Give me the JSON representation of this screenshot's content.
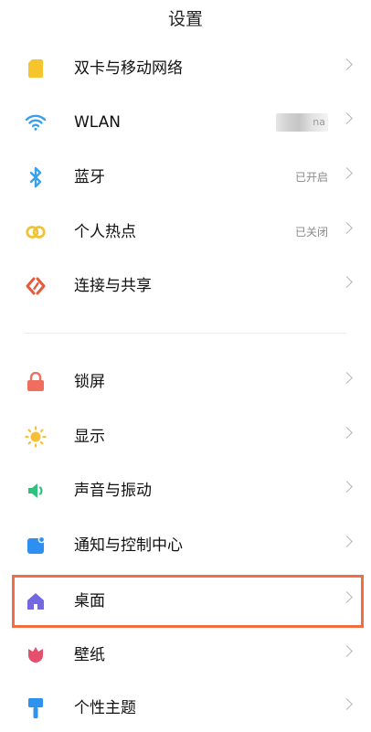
{
  "header": {
    "title": "设置"
  },
  "wlan_ssid_tail": "na",
  "colors": {
    "highlight": "#f16e43",
    "sim": "#f6c42c",
    "wlan": "#3aa0ea",
    "bluetooth": "#3aa0ea",
    "hotspot": "#f0c335",
    "connect": "#e55a3b",
    "lock": "#ef6e5d",
    "display": "#f7c034",
    "sound": "#2ec27e",
    "notify": "#2e8ef2",
    "home": "#7468e0",
    "wallpaper": "#e34f6d",
    "theme": "#2d93ee"
  },
  "sections": [
    {
      "items": [
        {
          "label": "双卡与移动网络",
          "icon": "sim-card-icon"
        },
        {
          "label": "WLAN",
          "icon": "wifi-icon"
        },
        {
          "label": "蓝牙",
          "status": "已开启",
          "icon": "bluetooth-icon"
        },
        {
          "label": "个人热点",
          "status": "已关闭",
          "icon": "hotspot-icon"
        },
        {
          "label": "连接与共享",
          "icon": "connect-share-icon"
        }
      ]
    },
    {
      "items": [
        {
          "label": "锁屏",
          "icon": "lock-icon"
        },
        {
          "label": "显示",
          "icon": "sun-icon"
        },
        {
          "label": "声音与振动",
          "icon": "speaker-icon"
        },
        {
          "label": "通知与控制中心",
          "icon": "notification-icon"
        },
        {
          "label": "桌面",
          "icon": "home-icon",
          "highlighted": true
        },
        {
          "label": "壁纸",
          "icon": "tulip-icon"
        },
        {
          "label": "个性主题",
          "icon": "paint-brush-icon"
        }
      ]
    }
  ]
}
